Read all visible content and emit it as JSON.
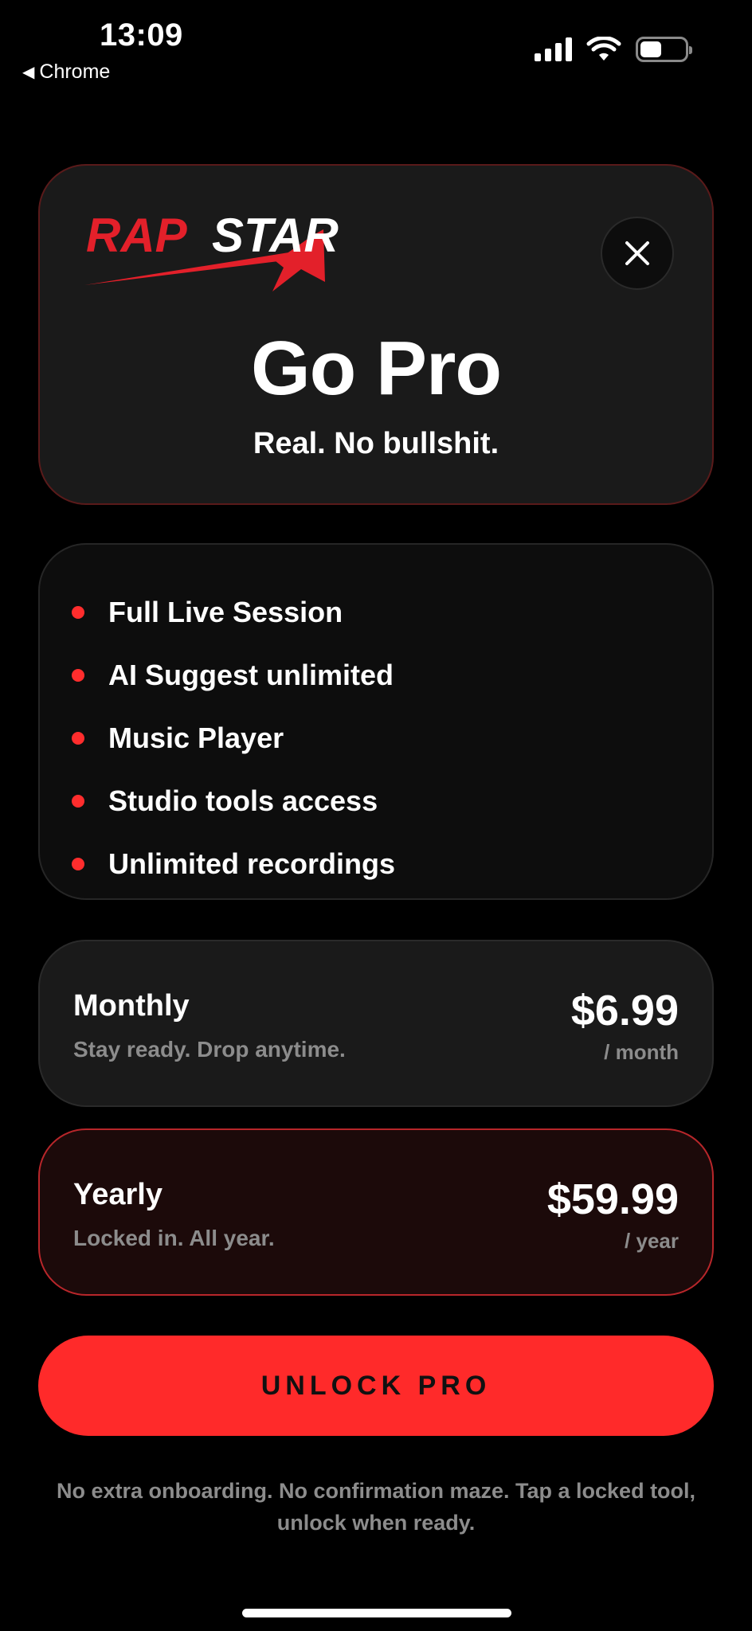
{
  "status_bar": {
    "time": "13:09",
    "back_label": "Chrome",
    "back_icon": "back-triangle-icon",
    "icons": [
      "cellular-signal-icon",
      "wifi-icon",
      "battery-icon"
    ]
  },
  "hero": {
    "logo_text": "RAPSTAR",
    "close_icon": "close-icon",
    "title": "Go Pro",
    "subtitle": "Real. No bullshit."
  },
  "features": [
    {
      "label": "Full Live Session"
    },
    {
      "label": "AI Suggest unlimited"
    },
    {
      "label": "Music Player"
    },
    {
      "label": "Studio tools access"
    },
    {
      "label": "Unlimited recordings"
    }
  ],
  "plans": {
    "monthly": {
      "name": "Monthly",
      "tagline": "Stay ready. Drop anytime.",
      "price": "$6.99",
      "period": "/ month"
    },
    "yearly": {
      "name": "Yearly",
      "tagline": "Locked in. All year.",
      "price": "$59.99",
      "period": "/ year",
      "selected": true
    }
  },
  "cta": {
    "label": "UNLOCK PRO"
  },
  "footnote": "No extra onboarding. No confirmation maze. Tap a locked tool, unlock when ready.",
  "colors": {
    "accent": "#ff2a2a",
    "background": "#000000",
    "card": "#1a1a1a",
    "muted_text": "#8c8c8c"
  }
}
